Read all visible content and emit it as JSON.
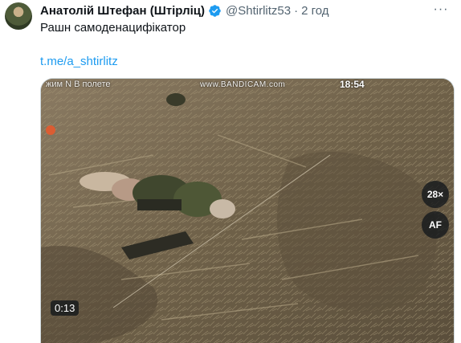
{
  "tweet": {
    "author_name": "Анатолій Штефан (Штірліц)",
    "handle": "@Shtirlitz53",
    "separator": "·",
    "time": "2 год",
    "more_label": "···",
    "text": "Рашн самоденацифікатор",
    "link": "t.me/a_shtirlitz"
  },
  "video": {
    "overlay_left": "жим N    В полете",
    "watermark": "www.BANDICAM.com",
    "overlay_right": "18:54",
    "speed_label": "28×",
    "af_label": "AF",
    "duration": "0:13"
  },
  "colors": {
    "link": "#1d9bf0",
    "verified": "#1d9bf0",
    "secondary_text": "#536471"
  },
  "icons": {
    "verified": "verified-badge-icon",
    "more": "more-options-icon"
  }
}
